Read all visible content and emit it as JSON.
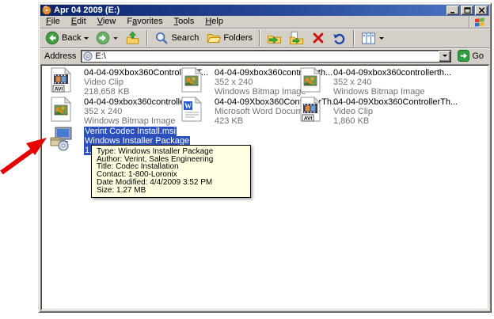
{
  "window": {
    "title": "Apr 04 2009 (E:)"
  },
  "menu": {
    "items": [
      {
        "pre": "",
        "accel": "F",
        "post": "ile"
      },
      {
        "pre": "",
        "accel": "E",
        "post": "dit"
      },
      {
        "pre": "",
        "accel": "V",
        "post": "iew"
      },
      {
        "pre": "F",
        "accel": "a",
        "post": "vorites"
      },
      {
        "pre": "",
        "accel": "T",
        "post": "ools"
      },
      {
        "pre": "",
        "accel": "H",
        "post": "elp"
      }
    ]
  },
  "toolbar": {
    "back_label": "Back",
    "search_label": "Search",
    "folders_label": "Folders"
  },
  "address_bar": {
    "label": "Address",
    "value": "E:\\",
    "go_label": "Go"
  },
  "files": [
    {
      "name": "04-04-09Xbox360ControllerKT...",
      "meta1": "Video Clip",
      "meta2": "218,658 KB",
      "type": "avi",
      "selected": false
    },
    {
      "name": "04-04-09xbox360controllerth...",
      "meta1": "352 x 240",
      "meta2": "Windows Bitmap Image",
      "type": "bmp",
      "selected": false
    },
    {
      "name": "04-04-09xbox360controllerth...",
      "meta1": "352 x 240",
      "meta2": "Windows Bitmap Image",
      "type": "bmp",
      "selected": false
    },
    {
      "name": "04-04-09xbox360controllerth...",
      "meta1": "352 x 240",
      "meta2": "Windows Bitmap Image",
      "type": "bmp",
      "selected": false
    },
    {
      "name": "04-04-09Xbox360ControllerTh...",
      "meta1": "Microsoft Word Document",
      "meta2": "423 KB",
      "type": "doc",
      "selected": false
    },
    {
      "name": "04-04-09Xbox360ControllerTh...",
      "meta1": "Video Clip",
      "meta2": "1,860 KB",
      "type": "avi",
      "selected": false
    },
    {
      "name": "Verint Codec Install.msi",
      "meta1": "Windows Installer Package",
      "meta2": "1,309 KB",
      "type": "msi",
      "selected": true
    }
  ],
  "tooltip": {
    "lines": [
      "Type: Windows Installer Package",
      "Author: Verint, Sales Engineering",
      "Title: Codec Installation",
      "Contact: 1-800-Loronix",
      "Date Modified: 4/4/2009 3:52 PM",
      "Size: 1.27 MB"
    ]
  },
  "colors": {
    "selection": "#2b50bd",
    "titlebar_start": "#0a246a",
    "titlebar_end": "#5078c8",
    "chrome": "#d4d0c8",
    "tooltip_bg": "#ffffe1",
    "arrow_red": "#e60000"
  }
}
